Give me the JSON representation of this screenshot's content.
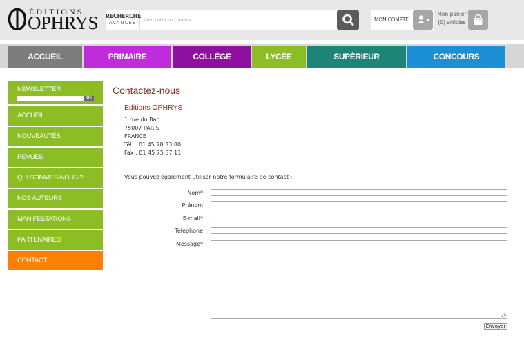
{
  "header": {
    "logo_small": "ÉDITIONS",
    "logo_big": "OPHRYS",
    "search": {
      "advanced_line1": "RECHERCHE",
      "advanced_line2": "AVANCÉE",
      "placeholder": "titre, collection, auteur..."
    },
    "account_label": "MON COMPTE",
    "cart_label": "Mon panier",
    "cart_count": "(0) articles"
  },
  "nav": {
    "items": [
      {
        "label": "ACCUEIL",
        "color": "#7d7d7d"
      },
      {
        "label": "PRIMAIRE",
        "color": "#c02bdc"
      },
      {
        "label": "COLLÈGE",
        "color": "#8f0fa0"
      },
      {
        "label": "LYCÉE",
        "color": "#8cbd25"
      },
      {
        "label": "SUPÉRIEUR",
        "color": "#1e8475"
      },
      {
        "label": "CONCOURS",
        "color": "#1c8fd6"
      }
    ]
  },
  "sidebar": {
    "newsletter_title": "NEWSLETTER",
    "newsletter_ok": "Ok",
    "items": [
      {
        "label": "ACCUEIL"
      },
      {
        "label": "NOUVEAUTÉS"
      },
      {
        "label": "REVUES"
      },
      {
        "label": "QUI SOMMES-NOUS ?"
      },
      {
        "label": "NOS AUTEURS"
      },
      {
        "label": "MANIFESTATIONS"
      },
      {
        "label": "PARTENAIRES"
      },
      {
        "label": "CONTACT",
        "active": true
      }
    ],
    "colors": {
      "default": "#8cbd25",
      "active": "#ff7f00"
    }
  },
  "main": {
    "title": "Contactez-nous",
    "company": "Editions OPHRYS",
    "address": [
      "1 rue du Bac",
      "75007 PARIS",
      "FRANCE",
      "Tél. : 01 45 78 33 80",
      "Fax : 01 45 75 37 11"
    ],
    "intro": "Vous pouvez également utiliser notre formulaire de contact :",
    "form": {
      "nom": "Nom",
      "prenom": "Prénom",
      "email": "E-mail",
      "telephone": "Téléphone",
      "message": "Message",
      "required_mark": "*",
      "submit": "Envoyer"
    }
  }
}
